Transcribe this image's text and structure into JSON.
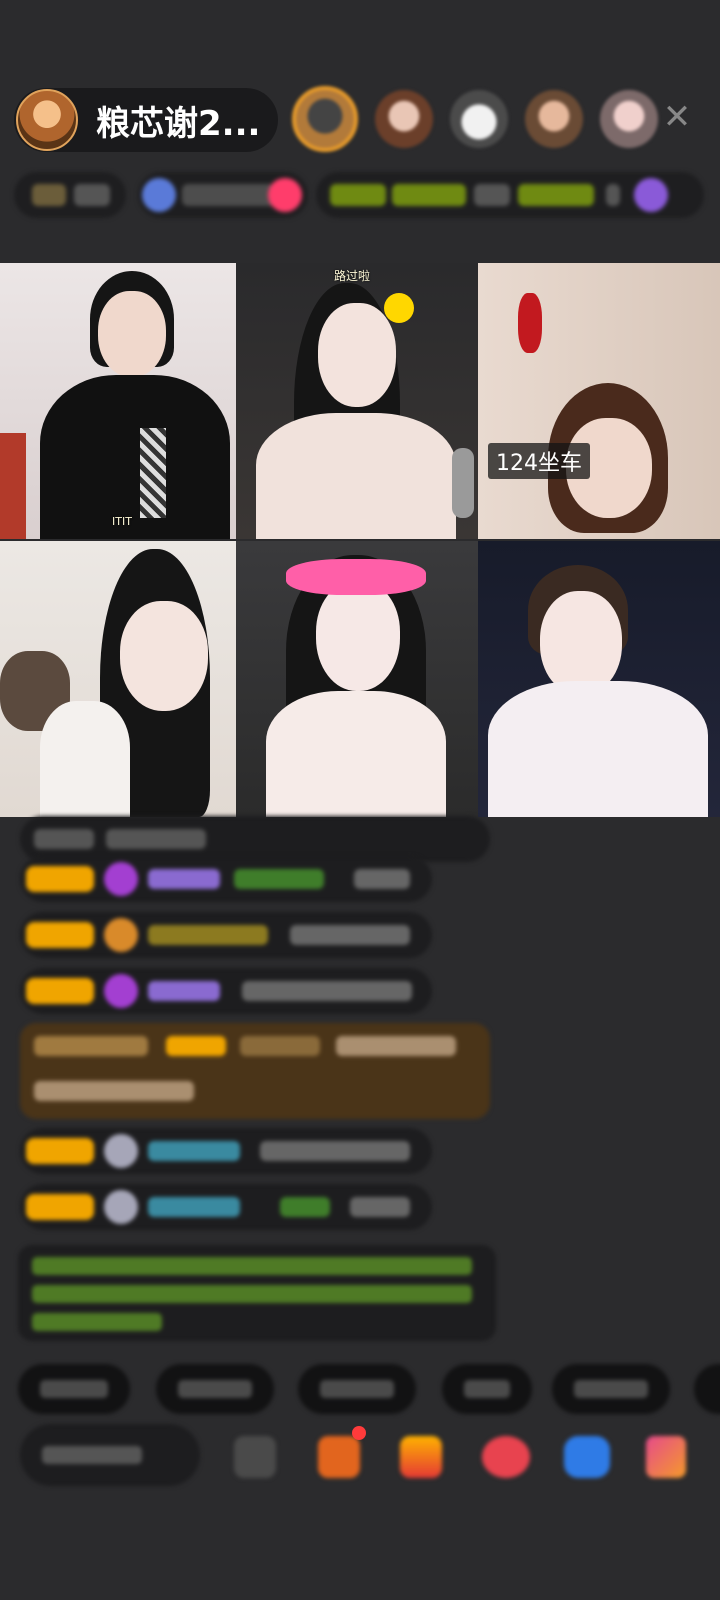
{
  "header": {
    "host_name": "粮芯谢2...",
    "close_symbol": "✕"
  },
  "grid": {
    "tiles": [
      {
        "caption": "ITIT"
      },
      {
        "caption": "路过啦"
      },
      {
        "caption": "124坐车"
      },
      {
        "caption": ""
      },
      {
        "caption": ""
      },
      {
        "caption": ""
      }
    ]
  },
  "colors": {
    "background": "#2b2b2d",
    "level_badge": "#f0a500",
    "chat_bubble": "#1d1d1f",
    "gift_highlight": "#4a3418",
    "system_text": "#7fb83a",
    "notification": "#ff3b3b"
  },
  "icons": [
    "close-icon",
    "emoji-icon",
    "gift-box-icon",
    "red-packet-icon",
    "shop-icon",
    "chat-icon",
    "grid-menu-icon"
  ]
}
